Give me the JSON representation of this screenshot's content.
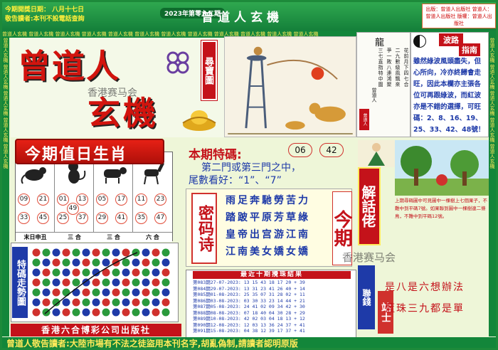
{
  "header": {
    "lottery_date": "今期開獎日期： 八月十七日",
    "reader_notice": "敬告讀者:本刊不設電話查詢",
    "issue": "2023年第零九二期",
    "title": "曾道人玄機",
    "publisher_note": "出版：曾道人出版社 曾道人：曾道人出版社 版權：曾道人出版社"
  },
  "bands": {
    "top": "曾道人玄機 曾道人玄機 曾道人玄機 曾道人玄機 曾道人玄機 曾道人玄機 曾道人玄機 曾道人玄機 曾道人玄機 曾道人玄機 曾道人玄機 曾道人玄機",
    "left": "曾道人玄機 曾道人玄機 曾道人玄機 曾道人玄機 曾道人玄機",
    "right": "曾道人玄機 曾道人玄機 曾道人玄機 曾道人玄機 曾道人玄機"
  },
  "logo": {
    "line1": "曾道人",
    "line2": "玄機",
    "watermark": "香港赛马会",
    "treasure_label": "尋寶圖"
  },
  "poem": {
    "title": "龍",
    "columns": [
      "花前月下四七合",
      "二九數級風飄來",
      "爭一敗八連鴻聚",
      "三七直指特中圍"
    ],
    "signature": "曾道人",
    "seal": "曾道人"
  },
  "tips": {
    "title_1": "波路",
    "title_2": "指南",
    "text": "雖然綠波風頭盡失，但心所向，冷亦終歸會走旺，因此本欄亦主張各位可再跟綠波，而紅波亦是不錯的選擇，可旺碼：2、8、16、19、25、33、42、48號！"
  },
  "today": {
    "title": "今期值日生肖",
    "zodiacs": [
      {
        "animal": "rat",
        "numbers": [
          "09",
          "21",
          "33",
          "45"
        ],
        "footer": "末日申丑"
      },
      {
        "animal": "monkey",
        "numbers": [
          "01",
          "13",
          "25",
          "37",
          "49"
        ],
        "footer": "三 合"
      },
      {
        "animal": "ox",
        "numbers": [
          "05",
          "17",
          "29",
          "41"
        ],
        "footer": "三 合"
      },
      {
        "animal": "horse",
        "numbers": [
          "11",
          "23",
          "35",
          "47"
        ],
        "footer": "六 合"
      }
    ]
  },
  "special": {
    "title": "本期特碼:",
    "numbers": [
      "06",
      "42"
    ],
    "line_1": "第二門或第三門之中，",
    "line_2": "尾數看好：“1”、“7”"
  },
  "mima": {
    "label": "密码诗",
    "rows": [
      "雨足奔馳勞苦力",
      "踏跛平原芳草綠",
      "皇帝出宫游江南",
      "江南美女嬌女嬌"
    ],
    "issue_label": "今期"
  },
  "results": {
    "header": "最近十期攪珠結果",
    "rows": [
      "第083期27-07-2023: 13 15 43 18 17 20 + 39",
      "第084期29-07-2023: 13 31 23 41 26 40 + 14",
      "第085期01-08-2023: 25 35 07 31 28 02 + 11",
      "第086期03-08-2023: 03 30 33 23 14 44 + 21",
      "第087期05-08-2023: 24 41 02 09 34 42 + 30",
      "第088期08-08-2023: 07 18 40 04 30 28 + 29",
      "第089期10-08-2023: 42 02 03 04 18 13 + 12",
      "第090期12-08-2023: 12 03 13 36 24 37 + 41",
      "第091期15-08-2023: 04 38 12 39 17 37 + 41"
    ]
  },
  "riddle": {
    "label": "解話佬",
    "text": "上期尋碼圖中可見圖中一棵樹上七個果子，不難中到平碼7號。如果聯到圖中一棵樹連二條鳥，不難中到平碼12號。",
    "watermark": "香港赛马会",
    "gems_label": "聯錢",
    "sage_label": "站士",
    "gems_line_1": "是八是六想辦法",
    "gems_line_2": "藍珠三九都是單"
  },
  "trend": {
    "label": "特碼走勢圖",
    "company": "香港六合博彩公司出版社"
  },
  "footer": {
    "text": "曾道人敬告讀者:大陸市場有不法之徒盜用本刊名字,胡亂偽制,請讀者認明原版"
  },
  "colors": {
    "red": "#c4121a",
    "green": "#13863a",
    "blue": "#1e3aa8",
    "yellow": "#ffe95a"
  }
}
